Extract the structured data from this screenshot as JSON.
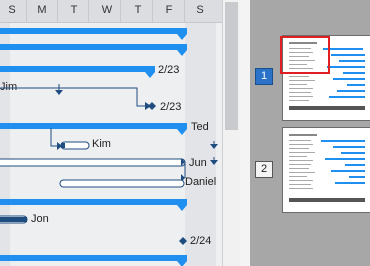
{
  "days": [
    "S",
    "M",
    "T",
    "W",
    "T",
    "F",
    "S"
  ],
  "labels": {
    "date_1": "2/23",
    "date_2": "2/23",
    "date_3": "2/24",
    "res_jim": "Jim",
    "res_kim": "Kim",
    "res_ted": "Ted",
    "res_jun": "Jun",
    "res_daniel": "Daniel",
    "res_jon": "Jon"
  },
  "pages": [
    {
      "number": "1",
      "active": true
    },
    {
      "number": "2",
      "active": false
    }
  ],
  "colors": {
    "task_bar": "#1f8ff0",
    "milestone": "#1f4d80",
    "active_page": "#2a73c8",
    "viewport_frame": "#e02020"
  }
}
